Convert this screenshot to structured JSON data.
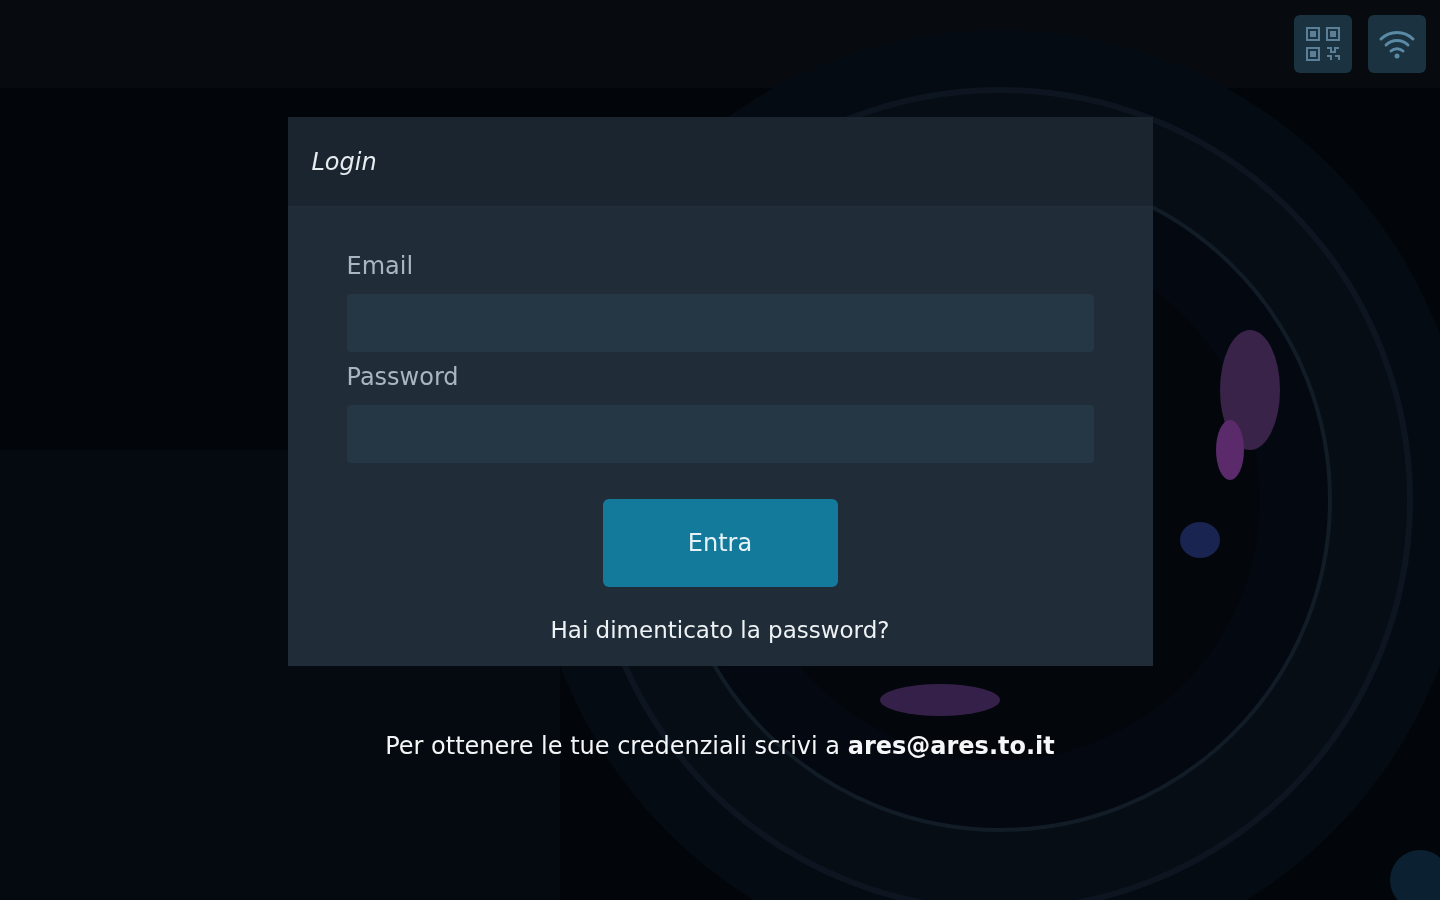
{
  "login": {
    "title": "Login",
    "fields": [
      {
        "label": "Email"
      },
      {
        "label": "Password"
      }
    ],
    "submit": "Entra",
    "forgot_link": "Hai dimenticato la password?"
  },
  "footer_note": "Per ottenere le tue credenziali scrivi a **ares@ares.to.it**"
}
